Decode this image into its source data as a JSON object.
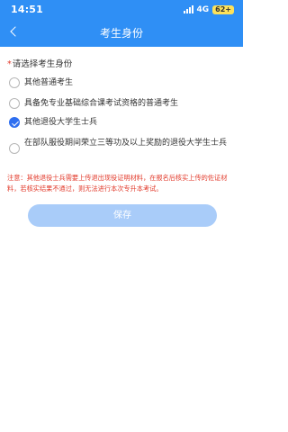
{
  "status_bar": {
    "time": "14:51",
    "network": "4G",
    "battery": "62+"
  },
  "nav": {
    "title": "考生身份"
  },
  "form": {
    "required_mark": "*",
    "question": "请选择考生身份",
    "options": [
      {
        "label": "其他普通考生",
        "selected": false
      },
      {
        "label": "具备免专业基础综合课考试资格的普通考生",
        "selected": false
      },
      {
        "label": "其他退役大学生士兵",
        "selected": true
      },
      {
        "label": "在部队服役期间荣立三等功及以上奖励的退役大学生士兵",
        "selected": false
      }
    ],
    "notice": "注意：其他退役士兵需要上传退出现役证明材料，在报名后核实上传的佐证材料，若核实结果不通过，则无法进行本次专升本考试。",
    "save_label": "保存"
  },
  "colors": {
    "header": "#2f8ff5",
    "accent": "#2f6ff0",
    "warning": "#e23a2b",
    "save_disabled": "#a9ccf9"
  }
}
